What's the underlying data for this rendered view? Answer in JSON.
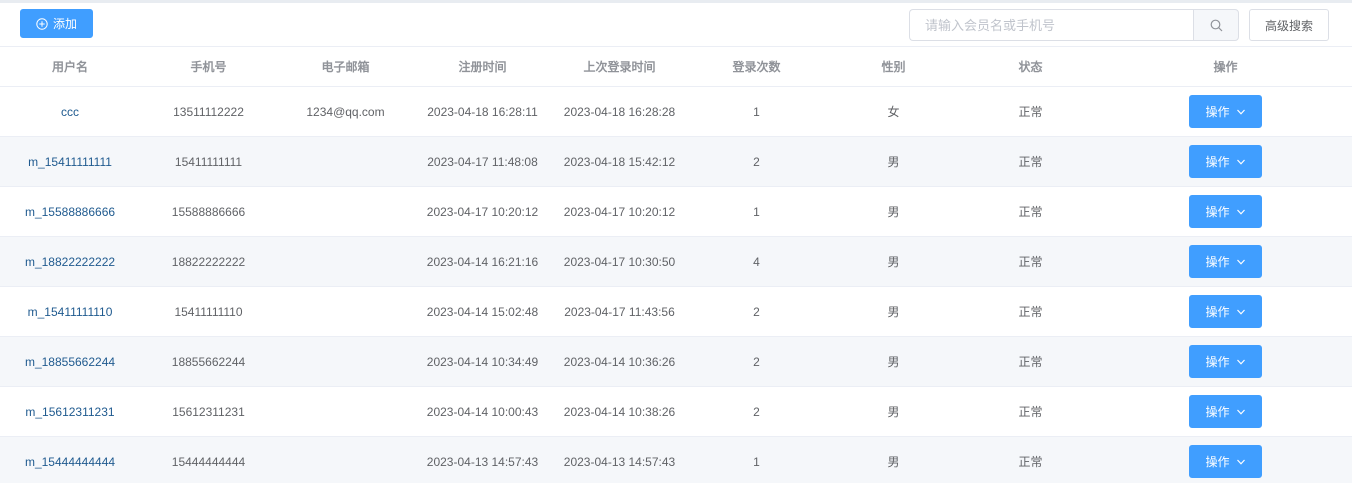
{
  "toolbar": {
    "add_label": "添加",
    "search_placeholder": "请输入会员名或手机号",
    "search_value": "",
    "advanced_search_label": "高级搜索"
  },
  "table": {
    "columns": [
      "用户名",
      "手机号",
      "电子邮箱",
      "注册时间",
      "上次登录时间",
      "登录次数",
      "性别",
      "状态",
      "操作"
    ],
    "rows": [
      {
        "username": "ccc",
        "phone": "13511112222",
        "email": "1234@qq.com",
        "registered": "2023-04-18 16:28:11",
        "last_login": "2023-04-18 16:28:28",
        "login_count": "1",
        "gender": "女",
        "status": "正常",
        "action": "操作"
      },
      {
        "username": "m_15411111111",
        "phone": "15411111111",
        "email": "",
        "registered": "2023-04-17 11:48:08",
        "last_login": "2023-04-18 15:42:12",
        "login_count": "2",
        "gender": "男",
        "status": "正常",
        "action": "操作"
      },
      {
        "username": "m_15588886666",
        "phone": "15588886666",
        "email": "",
        "registered": "2023-04-17 10:20:12",
        "last_login": "2023-04-17 10:20:12",
        "login_count": "1",
        "gender": "男",
        "status": "正常",
        "action": "操作"
      },
      {
        "username": "m_18822222222",
        "phone": "18822222222",
        "email": "",
        "registered": "2023-04-14 16:21:16",
        "last_login": "2023-04-17 10:30:50",
        "login_count": "4",
        "gender": "男",
        "status": "正常",
        "action": "操作"
      },
      {
        "username": "m_15411111110",
        "phone": "15411111110",
        "email": "",
        "registered": "2023-04-14 15:02:48",
        "last_login": "2023-04-17 11:43:56",
        "login_count": "2",
        "gender": "男",
        "status": "正常",
        "action": "操作"
      },
      {
        "username": "m_18855662244",
        "phone": "18855662244",
        "email": "",
        "registered": "2023-04-14 10:34:49",
        "last_login": "2023-04-14 10:36:26",
        "login_count": "2",
        "gender": "男",
        "status": "正常",
        "action": "操作"
      },
      {
        "username": "m_15612311231",
        "phone": "15612311231",
        "email": "",
        "registered": "2023-04-14 10:00:43",
        "last_login": "2023-04-14 10:38:26",
        "login_count": "2",
        "gender": "男",
        "status": "正常",
        "action": "操作"
      },
      {
        "username": "m_15444444444",
        "phone": "15444444444",
        "email": "",
        "registered": "2023-04-13 14:57:43",
        "last_login": "2023-04-13 14:57:43",
        "login_count": "1",
        "gender": "男",
        "status": "正常",
        "action": "操作"
      }
    ]
  },
  "icons": {
    "add": "plus-circle-icon",
    "search": "search-icon",
    "dropdown": "chevron-down-icon"
  },
  "colors": {
    "primary": "#409eff",
    "username_link": "#1f5a8f",
    "stripe": "#f5f7fa"
  }
}
